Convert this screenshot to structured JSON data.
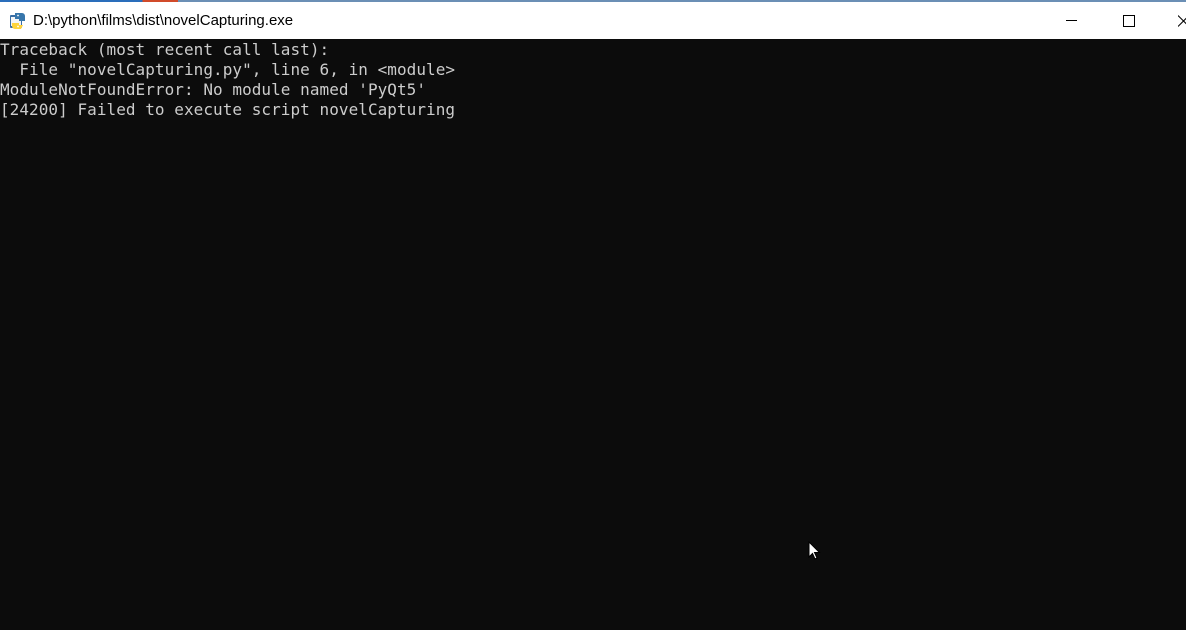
{
  "window": {
    "title": "D:\\python\\films\\dist\\novelCapturing.exe"
  },
  "console": {
    "lines": [
      "Traceback (most recent call last):",
      "  File \"novelCapturing.py\", line 6, in <module>",
      "ModuleNotFoundError: No module named 'PyQt5'",
      "[24200] Failed to execute script novelCapturing"
    ],
    "text_color": "#cccccc",
    "background": "#0c0c0c"
  },
  "icons": {
    "app": "python-app-icon",
    "minimize": "minimize-icon",
    "maximize": "maximize-icon",
    "close": "close-icon",
    "pointer": "mouse-pointer-icon"
  }
}
